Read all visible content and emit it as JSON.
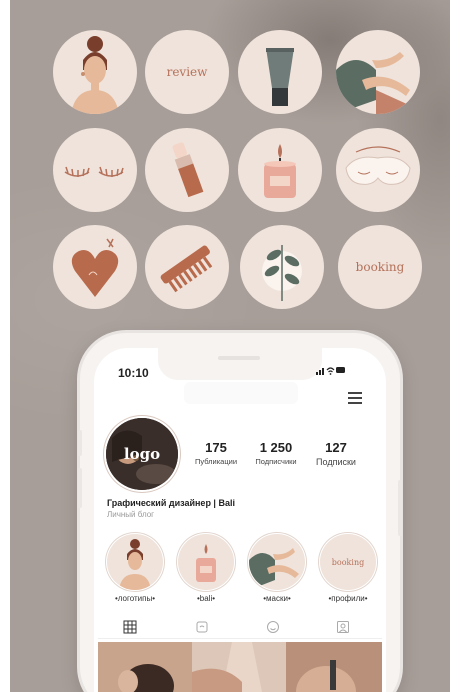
{
  "highlight_grid": [
    {
      "name": "woman",
      "text": ""
    },
    {
      "name": "review",
      "text": "review"
    },
    {
      "name": "tube",
      "text": ""
    },
    {
      "name": "legs",
      "text": ""
    },
    {
      "name": "lashes",
      "text": ""
    },
    {
      "name": "lipstick",
      "text": ""
    },
    {
      "name": "candle",
      "text": ""
    },
    {
      "name": "sleep-mask",
      "text": ""
    },
    {
      "name": "heart",
      "text": ""
    },
    {
      "name": "comb",
      "text": ""
    },
    {
      "name": "plant",
      "text": ""
    },
    {
      "name": "booking",
      "text": "booking"
    }
  ],
  "status_bar": {
    "time": "10:10",
    "icons": "signal-wifi-battery"
  },
  "profile": {
    "avatar_text": "logo",
    "stats": [
      {
        "value": "175",
        "label": "Публикации"
      },
      {
        "value": "1 250",
        "label": "Подписчики"
      },
      {
        "value": "127",
        "label": "Подписки"
      }
    ],
    "name": "Графический дизайнер | Bali",
    "category": "Личный блог"
  },
  "story_highlights": [
    {
      "label": "•логотипы•",
      "icon": "woman"
    },
    {
      "label": "•bali•",
      "icon": "candle"
    },
    {
      "label": "•маски•",
      "icon": "legs"
    },
    {
      "label": "•профили•",
      "icon": "booking",
      "text": "booking"
    }
  ],
  "tabs": [
    "grid-icon",
    "reels-icon",
    "smile-icon",
    "tagged-icon"
  ],
  "colors": {
    "background": "#a89e99",
    "circle": "#efe3db",
    "accent": "#b5715a",
    "dark_green": "#5b6d63"
  }
}
